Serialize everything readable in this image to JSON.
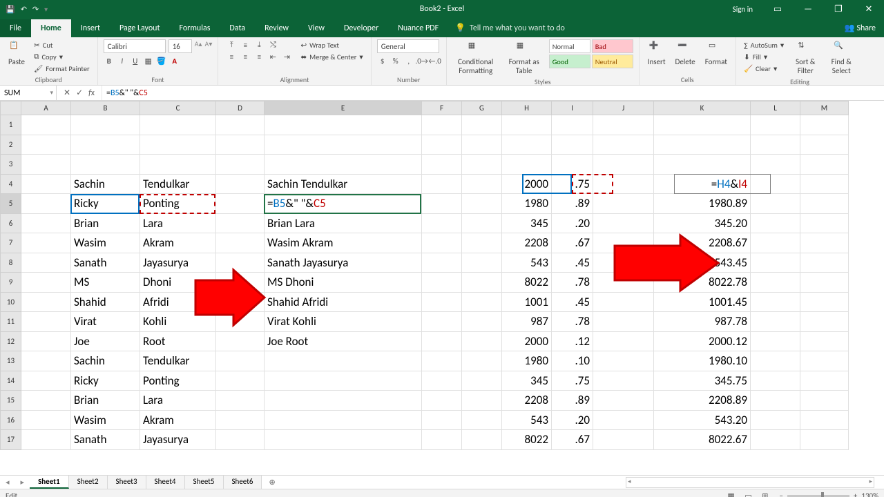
{
  "title": "Book2 - Excel",
  "signin": "Sign in",
  "tabs": [
    "File",
    "Home",
    "Insert",
    "Page Layout",
    "Formulas",
    "Data",
    "Review",
    "View",
    "Developer",
    "Nuance PDF"
  ],
  "active_tab": "Home",
  "tell_me": "Tell me what you want to do",
  "share": "Share",
  "ribbon": {
    "clipboard": {
      "paste": "Paste",
      "cut": "Cut",
      "copy": "Copy",
      "painter": "Format Painter",
      "label": "Clipboard"
    },
    "font": {
      "name": "Calibri",
      "size": "16",
      "label": "Font"
    },
    "alignment": {
      "wrap": "Wrap Text",
      "merge": "Merge & Center",
      "label": "Alignment"
    },
    "number": {
      "format": "General",
      "label": "Number"
    },
    "styles": {
      "cf": "Conditional Formatting",
      "fat": "Format as Table",
      "cells": [
        "Normal",
        "Bad",
        "Good",
        "Neutral"
      ],
      "label": "Styles"
    },
    "cells": {
      "insert": "Insert",
      "delete": "Delete",
      "format": "Format",
      "label": "Cells"
    },
    "editing": {
      "autosum": "AutoSum",
      "fill": "Fill",
      "clear": "Clear",
      "sort": "Sort & Filter",
      "find": "Find & Select",
      "label": "Editing"
    }
  },
  "namebox": "SUM",
  "formula_tokens": [
    "=",
    "B5",
    "&\" \"&",
    "C5"
  ],
  "columns": [
    "A",
    "B",
    "C",
    "D",
    "E",
    "F",
    "G",
    "H",
    "I",
    "J",
    "K",
    "L",
    "M"
  ],
  "rows": [
    {
      "r": 1
    },
    {
      "r": 2
    },
    {
      "r": 3
    },
    {
      "r": 4,
      "B": "Sachin",
      "C": "Tendulkar",
      "E": "Sachin  Tendulkar",
      "H": "2000",
      "I": ".75",
      "K": "=H4&I4"
    },
    {
      "r": 5,
      "B": "Ricky",
      "C": "Ponting",
      "E": "=B5&\" \"&C5",
      "H": "1980",
      "I": ".89",
      "K": "1980.89"
    },
    {
      "r": 6,
      "B": "Brian",
      "C": "Lara",
      "E": "Brian Lara",
      "H": "345",
      "I": ".20",
      "K": "345.20"
    },
    {
      "r": 7,
      "B": "Wasim",
      "C": "Akram",
      "E": "Wasim  Akram",
      "H": "2208",
      "I": ".67",
      "K": "2208.67"
    },
    {
      "r": 8,
      "B": "Sanath",
      "C": "Jayasurya",
      "E": "Sanath  Jayasurya",
      "H": "543",
      "I": ".45",
      "K": "543.45"
    },
    {
      "r": 9,
      "B": "MS",
      "C": "Dhoni",
      "E": "MS Dhoni",
      "H": "8022",
      "I": ".78",
      "K": "8022.78"
    },
    {
      "r": 10,
      "B": "Shahid",
      "C": "Afridi",
      "E": "Shahid Afridi",
      "H": "1001",
      "I": ".45",
      "K": "1001.45"
    },
    {
      "r": 11,
      "B": "Virat",
      "C": "Kohli",
      "E": "Virat Kohli",
      "H": "987",
      "I": ".78",
      "K": "987.78"
    },
    {
      "r": 12,
      "B": "Joe",
      "C": "Root",
      "E": "Joe  Root",
      "H": "2000",
      "I": ".12",
      "K": "2000.12"
    },
    {
      "r": 13,
      "B": "Sachin",
      "C": "Tendulkar",
      "H": "1980",
      "I": ".10",
      "K": "1980.10"
    },
    {
      "r": 14,
      "B": "Ricky",
      "C": "Ponting",
      "H": "345",
      "I": ".75",
      "K": "345.75"
    },
    {
      "r": 15,
      "B": "Brian",
      "C": "Lara",
      "H": "2208",
      "I": ".89",
      "K": "2208.89"
    },
    {
      "r": 16,
      "B": "Wasim",
      "C": "Akram",
      "H": "543",
      "I": ".20",
      "K": "543.20"
    },
    {
      "r": 17,
      "B": "Sanath",
      "C": "Jayasurya",
      "H": "8022",
      "I": ".67",
      "K": "8022.67"
    }
  ],
  "sheets": [
    "Sheet1",
    "Sheet2",
    "Sheet3",
    "Sheet4",
    "Sheet5",
    "Sheet6"
  ],
  "active_sheet": "Sheet1",
  "status_mode": "Edit",
  "zoom": "130%"
}
